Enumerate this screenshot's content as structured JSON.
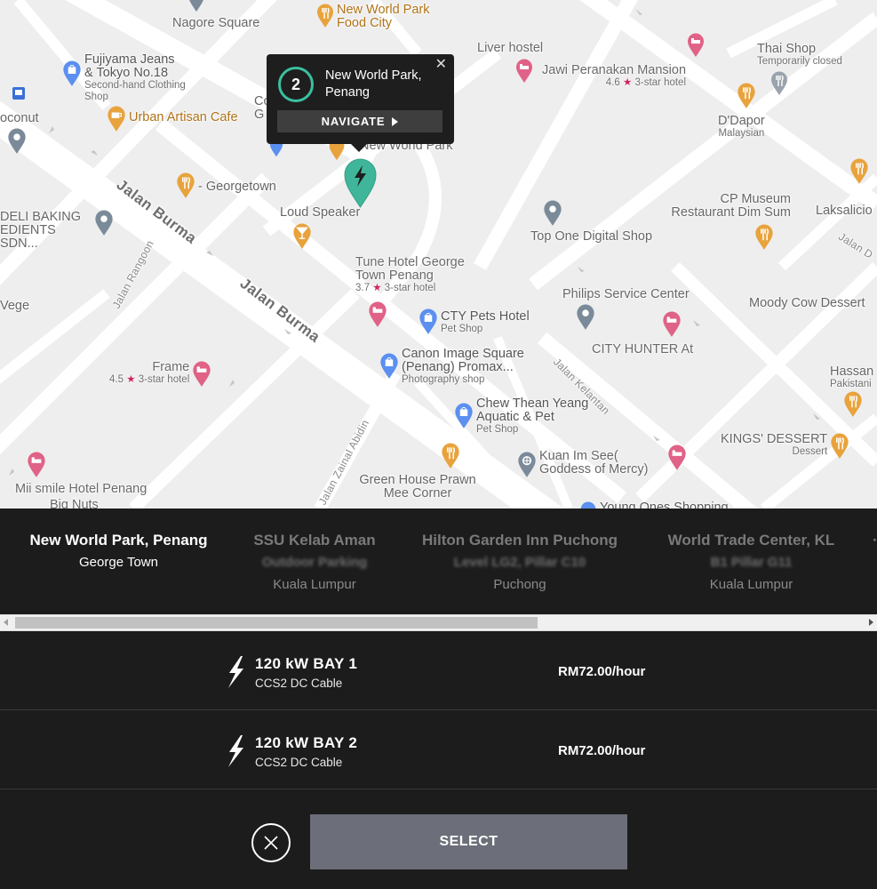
{
  "map": {
    "pois": [
      {
        "name": "Nagore Square",
        "cat": "plain"
      },
      {
        "name": "New World Park Food City",
        "cat": "food"
      },
      {
        "name": "Liver hostel",
        "cat": "hotel"
      },
      {
        "name": "Thai Shop",
        "sub": "Temporarily closed",
        "cat": "food"
      },
      {
        "name": "Fujiyama Jeans & Tokyo No.18",
        "sub": "Second-hand Clothing Shop",
        "cat": "shop"
      },
      {
        "name": "Jawi Peranakan Mansion",
        "rating": "4.6",
        "sub": "3-star hotel",
        "cat": "hotel"
      },
      {
        "name": "oconut",
        "cat": "plain"
      },
      {
        "name": "Urban Artisan Cafe",
        "cat": "food"
      },
      {
        "name": "D'Dapor",
        "sub": "Malaysian",
        "cat": "food"
      },
      {
        "name": "- Georgetown",
        "cat": "food"
      },
      {
        "name": "Loud Speaker",
        "cat": "food"
      },
      {
        "name": "DELI BAKING EDIENTS SDN...",
        "cat": "plain"
      },
      {
        "name": "CP Museum Restaurant Dim Sum",
        "cat": "food"
      },
      {
        "name": "Laksalicio",
        "cat": "food"
      },
      {
        "name": "Top One Digital Shop",
        "cat": "plain"
      },
      {
        "name": "Tune Hotel George Town Penang",
        "rating": "3.7",
        "sub": "3-star hotel",
        "cat": "hotel"
      },
      {
        "name": "Philips Service Center",
        "cat": "plain"
      },
      {
        "name": "Moody Cow Dessert",
        "cat": "food"
      },
      {
        "name": "Vege",
        "cat": "plain"
      },
      {
        "name": "CTY Pets Hotel",
        "sub": "Pet Shop",
        "cat": "shop"
      },
      {
        "name": "CITY HUNTER At",
        "cat": "hotel"
      },
      {
        "name": "Canon Image Square (Penang) Promax...",
        "sub": "Photography shop",
        "cat": "shop"
      },
      {
        "name": "Frame",
        "rating": "4.5",
        "sub": "3-star hotel",
        "cat": "hotel"
      },
      {
        "name": "Hassan",
        "sub": "Pakistani",
        "cat": "food"
      },
      {
        "name": "Chew Thean Yeang Aquatic & Pet",
        "sub": "Pet Shop",
        "cat": "shop"
      },
      {
        "name": "KINGS' DESSERT",
        "sub": "Dessert",
        "cat": "food"
      },
      {
        "name": "Kuan Im See( Goddess of Mercy)",
        "cat": "plain"
      },
      {
        "name": "Mii smile Hotel Penang",
        "cat": "hotel"
      },
      {
        "name": "Big Nuts",
        "cat": "plain"
      },
      {
        "name": "Green House Prawn Mee Corner",
        "cat": "food"
      },
      {
        "name": "Young Ones Shopping",
        "cat": "shop"
      },
      {
        "name": "New World Park",
        "cat": "plain"
      },
      {
        "name": "Co G",
        "cat": "plain"
      }
    ],
    "streets": [
      "Jalan Burma",
      "Jalan Burma",
      "Jalan Rangoon",
      "Jalan Kelantan",
      "Jalan Zainal Abidin",
      "Jalan D"
    ],
    "popup": {
      "number": "2",
      "title": "New World Park, Penang",
      "navigate_label": "NAVIGATE",
      "close_glyph": "✕"
    },
    "colors": {
      "marker": "#3fb69a",
      "food": "#e8a33d",
      "hotel": "#e06287",
      "shop": "#5b8ff0",
      "generic": "#7b8a99"
    }
  },
  "locations": [
    {
      "name": "New World Park, Penang",
      "subtitle": "",
      "city": "George Town",
      "active": true
    },
    {
      "name": "SSU Kelab Aman",
      "subtitle": "Outdoor Parking",
      "city": "Kuala Lumpur",
      "active": false
    },
    {
      "name": "Hilton Garden Inn Puchong",
      "subtitle": "Level LG2, Pillar C10",
      "city": "Puchong",
      "active": false
    },
    {
      "name": "World Trade Center, KL",
      "subtitle": "B1 Pillar G11",
      "city": "Kuala Lumpur",
      "active": false
    }
  ],
  "scroll": {
    "position_fraction": 0.6
  },
  "bays": [
    {
      "name": "120 kW BAY 1",
      "type": "CCS2 DC Cable",
      "price": "RM72.00/hour"
    },
    {
      "name": "120 kW BAY 2",
      "type": "CCS2 DC Cable",
      "price": "RM72.00/hour"
    }
  ],
  "actions": {
    "select_label": "SELECT"
  }
}
